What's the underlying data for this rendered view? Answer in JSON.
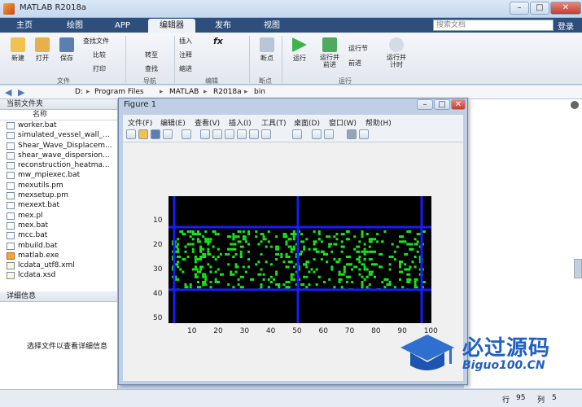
{
  "window": {
    "title": "MATLAB R2018a",
    "min": "–",
    "max": "□",
    "close": "✕"
  },
  "tabs": [
    {
      "label": "主页"
    },
    {
      "label": "绘图"
    },
    {
      "label": "APP"
    },
    {
      "label": "编辑器"
    },
    {
      "label": "发布"
    },
    {
      "label": "视图"
    }
  ],
  "search_placeholder": "搜索文档",
  "login": "登录",
  "ribbon": {
    "file": {
      "new": "新建",
      "open": "打开",
      "save": "保存",
      "find_files": "查找文件",
      "compare": "比较",
      "print": "打印",
      "group": "文件"
    },
    "nav": {
      "goto": "转至",
      "find": "查找",
      "group": "导航"
    },
    "edit": {
      "insert": "插入",
      "fx": "fx",
      "comment": "注释",
      "indent": "缩进",
      "group": "编辑"
    },
    "breakpoint": {
      "label": "断点",
      "group": "断点"
    },
    "run": {
      "run": "运行",
      "run_advance": "运行并\n前进",
      "run_section": "运行节",
      "advance": "前进",
      "run_time": "运行并\n计时",
      "group": "运行"
    }
  },
  "path": {
    "drive": "D:",
    "segments": [
      "Program Files",
      "MATLAB",
      "R2018a",
      "bin"
    ]
  },
  "current_folder": {
    "header": "当前文件夹",
    "col_name": "名称",
    "files": [
      {
        "name": "worker.bat",
        "type": "bat"
      },
      {
        "name": "simulated_vessel_wall_...",
        "type": "mat"
      },
      {
        "name": "Shear_Wave_Displacem...",
        "type": "mat"
      },
      {
        "name": "shear_wave_dispersion...",
        "type": "mat"
      },
      {
        "name": "reconstruction_heatma...",
        "type": "mat"
      },
      {
        "name": "mw_mpiexec.bat",
        "type": "bat"
      },
      {
        "name": "mexutils.pm",
        "type": "pm"
      },
      {
        "name": "mexsetup.pm",
        "type": "pm"
      },
      {
        "name": "mexext.bat",
        "type": "bat"
      },
      {
        "name": "mex.pl",
        "type": "pm"
      },
      {
        "name": "mex.bat",
        "type": "bat"
      },
      {
        "name": "mcc.bat",
        "type": "bat"
      },
      {
        "name": "mbuild.bat",
        "type": "bat"
      },
      {
        "name": "matlab.exe",
        "type": "exe"
      },
      {
        "name": "lcdata_utf8.xml",
        "type": "xml"
      },
      {
        "name": "lcdata.xsd",
        "type": "xml"
      }
    ]
  },
  "details": {
    "header": "详细信息",
    "empty_text": "选择文件以查看详细信息"
  },
  "status": {
    "row_label": "行",
    "row": "95",
    "col_label": "列",
    "col": "5"
  },
  "figure": {
    "title": "Figure 1",
    "menu": [
      "文件(F)",
      "编辑(E)",
      "查看(V)",
      "插入(I)",
      "工具(T)",
      "桌面(D)",
      "窗口(W)",
      "帮助(H)"
    ],
    "axes": {
      "xticks": [
        "10",
        "20",
        "30",
        "40",
        "50",
        "60",
        "70",
        "80",
        "90",
        "100"
      ],
      "yticks": [
        "10",
        "20",
        "30",
        "40",
        "50"
      ]
    }
  },
  "watermark": {
    "line1": "必过源码",
    "line2": "Biguo100.CN"
  },
  "colors": {
    "ribbon_tab_bg": "#2e4f7c",
    "plot_bg": "#000000",
    "dots": "#19e619",
    "grid_lines": "#1a1aff"
  }
}
